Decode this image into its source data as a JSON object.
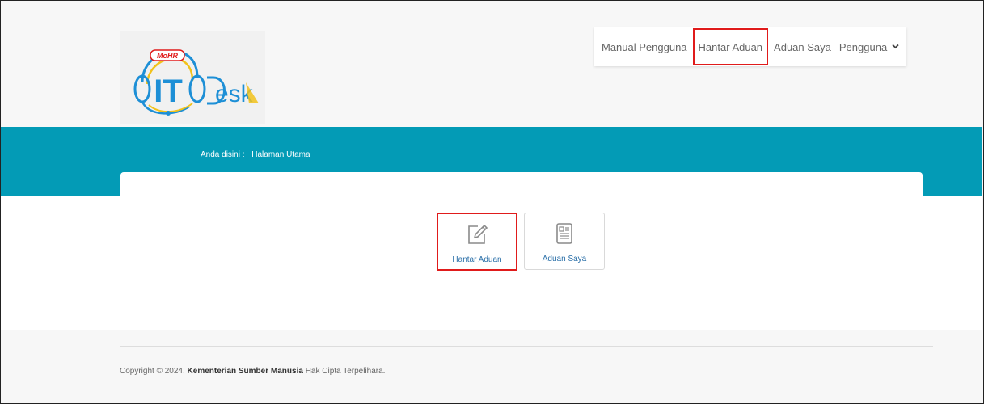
{
  "logo": {
    "badge_text": "MoHR",
    "it_text": "IT",
    "desk_text": "esk"
  },
  "nav": {
    "items": [
      {
        "label": "Manual Pengguna"
      },
      {
        "label": "Hantar Aduan"
      },
      {
        "label": "Aduan Saya"
      },
      {
        "label": "Pengguna"
      }
    ]
  },
  "breadcrumb": {
    "prefix": "Anda disini :",
    "current": "Halaman Utama"
  },
  "tiles": [
    {
      "label": "Hantar Aduan",
      "icon": "edit-icon"
    },
    {
      "label": "Aduan Saya",
      "icon": "document-icon"
    }
  ],
  "footer": {
    "copyright_prefix": "Copyright © 2024.",
    "organization": "Kementerian Sumber Manusia",
    "rights": "Hak Cipta Terpelihara."
  },
  "colors": {
    "teal": "#039bb6",
    "highlight": "#e01b1b",
    "link": "#2a6fa8",
    "logo_blue": "#1d8fd6",
    "logo_yellow": "#f2c21b",
    "logo_red": "#e01b1b"
  }
}
